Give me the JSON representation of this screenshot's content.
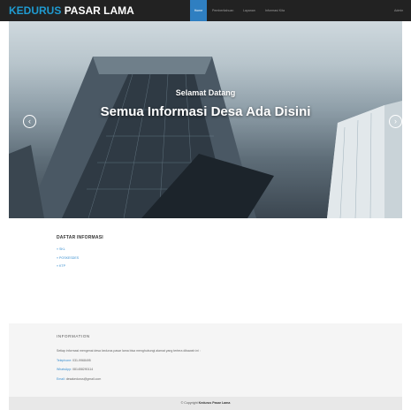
{
  "navbar": {
    "brand_part1": "KEDURUS",
    "brand_part2": "PASAR LAMA",
    "items": [
      {
        "label": "Home",
        "active": true
      },
      {
        "label": "Pemberitahuan",
        "active": false
      },
      {
        "label": "Layanan",
        "active": false
      },
      {
        "label": "Informasi Kita",
        "active": false
      }
    ],
    "right_label": "Admin"
  },
  "hero": {
    "subtitle": "Selamat Datang",
    "title": "Semua Informasi Desa Ada Disini",
    "prev_icon": "chevron-left-icon",
    "next_icon": "chevron-right-icon",
    "slide_count": 3,
    "active_slide": 1
  },
  "daftar": {
    "title": "DAFTAR INFORMASI",
    "items": [
      "SKL",
      "POSKESDES",
      "KTP"
    ]
  },
  "footer": {
    "title": "INFORMATION",
    "description": "Setiap informasi mengenai desa kedurus pasar lama bisa menghubungi alamat yang tertera dibawah ini :",
    "telephone_label": "Telephone:",
    "telephone_value": "031-9968495",
    "whatsapp_label": "WhatsApp:",
    "whatsapp_value": "081458290114",
    "email_label": "Email:",
    "email_value": "desakedurus@gmail.com",
    "copyright_prefix": "© Copyright",
    "copyright_name": "Kedurus Pasar Lama"
  },
  "colors": {
    "navbar_bg": "#222222",
    "brand_accent": "#1f9bd1",
    "active_nav": "#2f7fc1",
    "link": "#3a8fd0"
  }
}
